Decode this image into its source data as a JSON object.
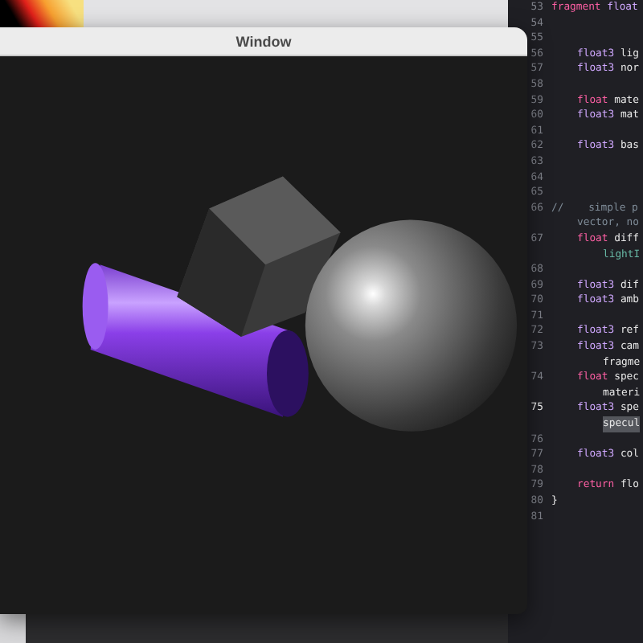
{
  "window": {
    "title": "Window"
  },
  "editor": {
    "lines": [
      {
        "number": "53",
        "indented": false,
        "current": false,
        "tokens": [
          {
            "text": "fragment",
            "kind": "keyword"
          },
          {
            "text": " float",
            "kind": "type"
          }
        ]
      },
      {
        "number": "54",
        "current": false
      },
      {
        "number": "55",
        "current": false
      },
      {
        "number": "56",
        "indented": true,
        "current": false,
        "tokens": [
          {
            "text": "float3",
            "kind": "type"
          },
          {
            "text": " lig",
            "kind": "plain"
          }
        ]
      },
      {
        "number": "57",
        "indented": true,
        "current": false,
        "tokens": [
          {
            "text": "float3",
            "kind": "type"
          },
          {
            "text": " nor",
            "kind": "plain"
          }
        ]
      },
      {
        "number": "58",
        "current": false
      },
      {
        "number": "59",
        "indented": true,
        "current": false,
        "tokens": [
          {
            "text": "float",
            "kind": "keyword"
          },
          {
            "text": " mate",
            "kind": "plain"
          }
        ]
      },
      {
        "number": "60",
        "indented": true,
        "current": false,
        "tokens": [
          {
            "text": "float3",
            "kind": "type"
          },
          {
            "text": " mat",
            "kind": "plain"
          }
        ]
      },
      {
        "number": "61",
        "current": false
      },
      {
        "number": "62",
        "indented": true,
        "current": false,
        "tokens": [
          {
            "text": "float3",
            "kind": "type"
          },
          {
            "text": " bas",
            "kind": "plain"
          }
        ]
      },
      {
        "number": "63",
        "current": false
      },
      {
        "number": "64",
        "current": false
      },
      {
        "number": "65",
        "current": false
      },
      {
        "number": "66",
        "indented": false,
        "current": false,
        "tokens": [
          {
            "text": "//    simple p",
            "kind": "comment"
          }
        ]
      },
      {
        "indented": true,
        "tokens": [
          {
            "text": "vector, no",
            "kind": "comment"
          }
        ]
      },
      {
        "number": "67",
        "indented": true,
        "current": false,
        "tokens": [
          {
            "text": "float",
            "kind": "keyword"
          },
          {
            "text": " diff",
            "kind": "plain"
          }
        ]
      },
      {
        "indented": true,
        "wrapped": true,
        "tokens": [
          {
            "text": "lightI",
            "kind": "name"
          }
        ]
      },
      {
        "number": "68",
        "current": false
      },
      {
        "number": "69",
        "indented": true,
        "current": false,
        "tokens": [
          {
            "text": "float3",
            "kind": "type"
          },
          {
            "text": " dif",
            "kind": "plain"
          }
        ]
      },
      {
        "number": "70",
        "indented": true,
        "current": false,
        "tokens": [
          {
            "text": "float3",
            "kind": "type"
          },
          {
            "text": " amb",
            "kind": "plain"
          }
        ]
      },
      {
        "number": "71",
        "current": false
      },
      {
        "number": "72",
        "indented": true,
        "current": false,
        "tokens": [
          {
            "text": "float3",
            "kind": "type"
          },
          {
            "text": " ref",
            "kind": "plain"
          }
        ]
      },
      {
        "number": "73",
        "indented": true,
        "current": false,
        "tokens": [
          {
            "text": "float3",
            "kind": "type"
          },
          {
            "text": " cam",
            "kind": "plain"
          }
        ]
      },
      {
        "indented": true,
        "wrapped": true,
        "tokens": [
          {
            "text": "fragme",
            "kind": "plain"
          }
        ]
      },
      {
        "number": "74",
        "indented": true,
        "current": false,
        "tokens": [
          {
            "text": "float",
            "kind": "keyword"
          },
          {
            "text": " spec",
            "kind": "plain"
          }
        ]
      },
      {
        "indented": true,
        "wrapped": true,
        "tokens": [
          {
            "text": "materi",
            "kind": "plain"
          }
        ]
      },
      {
        "number": "75",
        "indented": true,
        "current": true,
        "tokens": [
          {
            "text": "float3",
            "kind": "type"
          },
          {
            "text": " spe",
            "kind": "plain"
          }
        ]
      },
      {
        "indented": true,
        "wrapped": true,
        "tokens": [
          {
            "text": "specul",
            "kind": "highlight"
          }
        ]
      },
      {
        "number": "76",
        "current": false
      },
      {
        "number": "77",
        "indented": true,
        "current": false,
        "tokens": [
          {
            "text": "float3",
            "kind": "type"
          },
          {
            "text": " col",
            "kind": "plain"
          }
        ]
      },
      {
        "number": "78",
        "current": false
      },
      {
        "number": "79",
        "indented": true,
        "current": false,
        "tokens": [
          {
            "text": "return",
            "kind": "keyword"
          },
          {
            "text": " flo",
            "kind": "plain"
          }
        ]
      },
      {
        "number": "80",
        "indented": false,
        "current": false,
        "tokens": [
          {
            "text": "}",
            "kind": "plain"
          }
        ]
      },
      {
        "number": "81",
        "current": false
      }
    ]
  }
}
